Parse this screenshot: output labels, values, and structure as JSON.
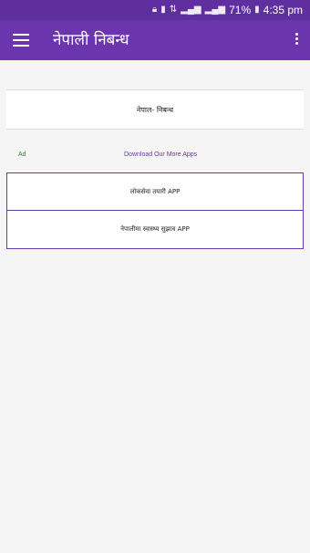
{
  "status_bar": {
    "battery": "71%",
    "time": "4:35 pm"
  },
  "app_bar": {
    "title": "नेपाली निबन्ध"
  },
  "main": {
    "essay_item": "नेपाल- निबन्ध",
    "ad_label": "Ad",
    "more_apps_link": "Download Our More Apps",
    "apps": [
      {
        "label": "लोकसेवा तयारी APP"
      },
      {
        "label": "नेपालीमा स्वास्थ्य सुझाव APP"
      }
    ]
  },
  "colors": {
    "status_bar": "#5f2fa0",
    "app_bar": "#6a35ad",
    "accent": "#6a35ad",
    "ad_label": "#2e7d32"
  }
}
